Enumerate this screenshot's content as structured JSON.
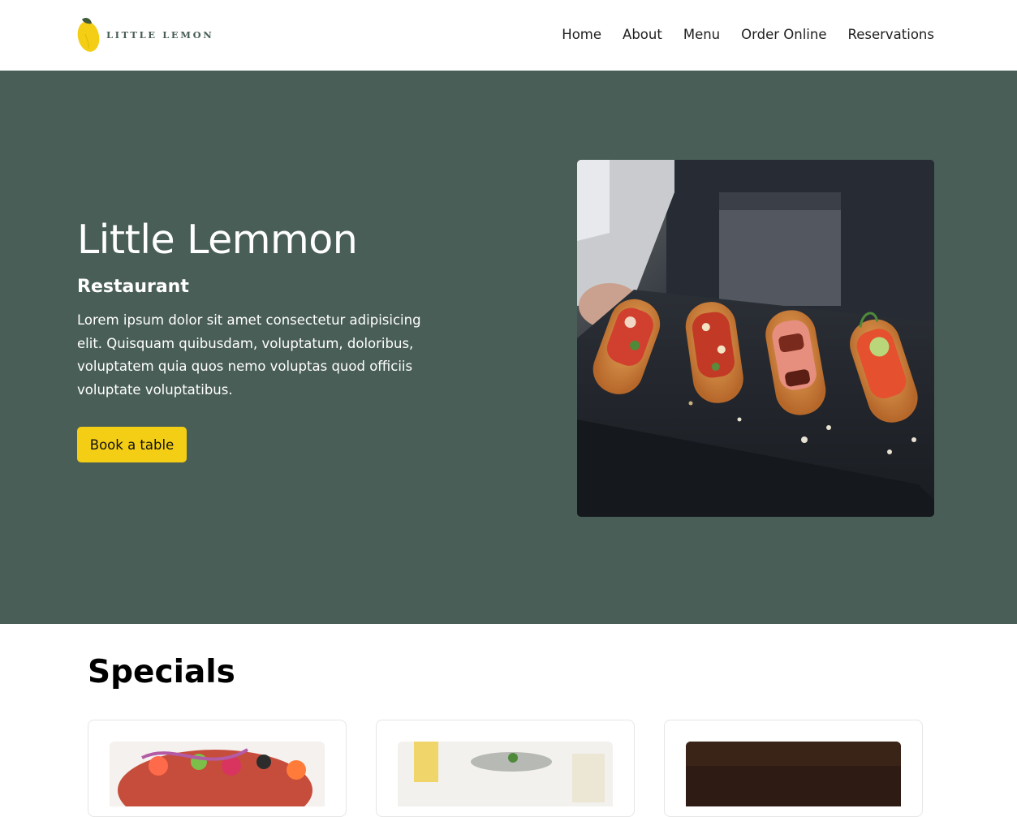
{
  "header": {
    "logo_text": "LITTLE LEMON",
    "logo_icon": "lemon-icon",
    "nav": [
      "Home",
      "About",
      "Menu",
      "Order Online",
      "Reservations"
    ]
  },
  "hero": {
    "title": "Little Lemmon",
    "subtitle": "Restaurant",
    "description": "Lorem ipsum dolor sit amet consectetur adipisicing elit. Quisquam quibusdam, voluptatum, doloribus, voluptatem quia quos nemo voluptas quod officiis voluptate voluptatibus.",
    "cta_label": "Book a table"
  },
  "specials": {
    "title": "Specials"
  },
  "colors": {
    "primary_green": "#495e57",
    "primary_yellow": "#f4ce14",
    "nav_text": "#1e1e1e"
  }
}
